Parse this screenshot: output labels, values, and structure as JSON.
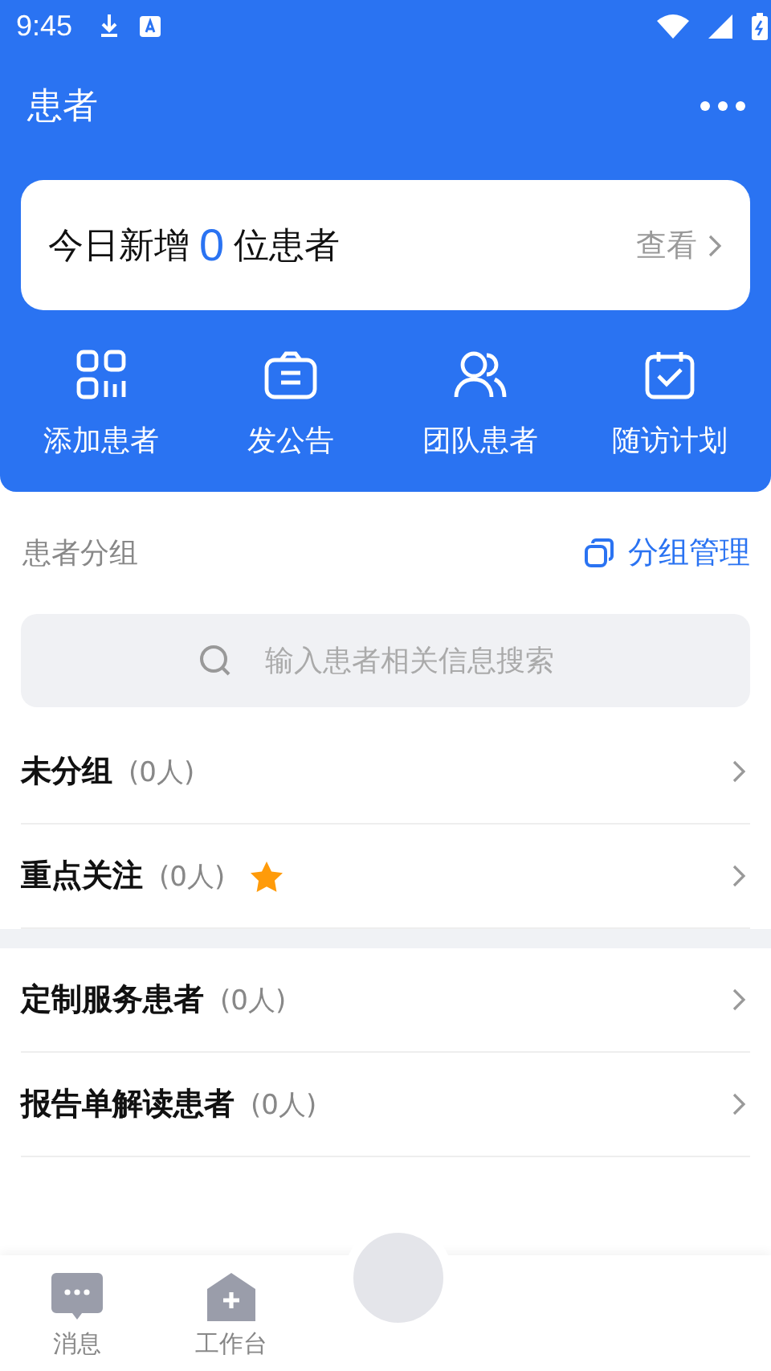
{
  "status_bar": {
    "time": "9:45"
  },
  "header": {
    "title": "患者"
  },
  "summary": {
    "prefix": "今日新增",
    "count": "0",
    "suffix": "位患者",
    "link": "查看"
  },
  "actions": [
    {
      "kind": "grid",
      "label": "添加患者"
    },
    {
      "kind": "bag",
      "label": "发公告"
    },
    {
      "kind": "people",
      "label": "团队患者"
    },
    {
      "kind": "calendar",
      "label": "随访计划"
    }
  ],
  "groups_header": {
    "title": "患者分组",
    "manage": "分组管理"
  },
  "search": {
    "placeholder": "输入患者相关信息搜索"
  },
  "group_sections": [
    [
      {
        "name": "未分组",
        "count": "(0人)",
        "starred": false
      },
      {
        "name": "重点关注",
        "count": "(0人)",
        "starred": true
      }
    ],
    [
      {
        "name": "定制服务患者",
        "count": "(0人)",
        "starred": false
      },
      {
        "name": "报告单解读患者",
        "count": "(0人)",
        "starred": false
      }
    ]
  ],
  "tab_bar": [
    {
      "kind": "chat",
      "label": "消息"
    },
    {
      "kind": "workbench",
      "label": "工作台"
    }
  ]
}
